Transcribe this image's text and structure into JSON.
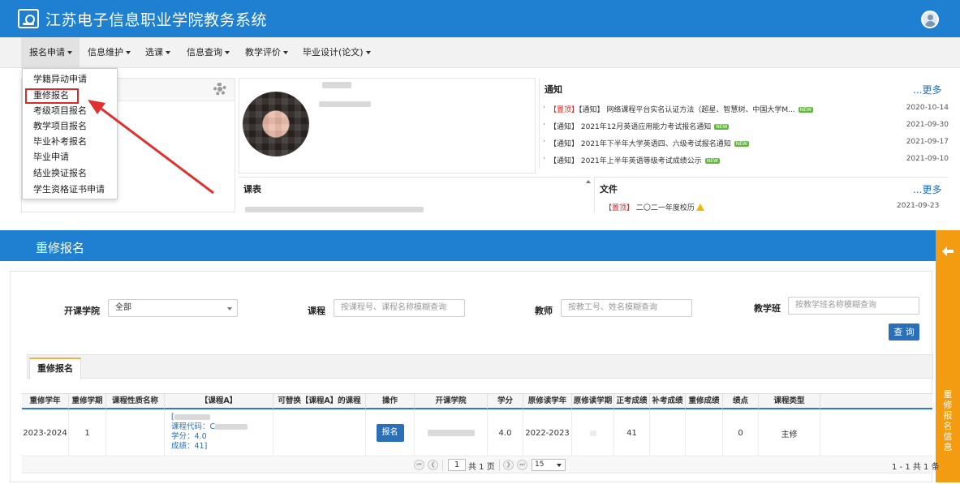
{
  "top": {
    "app_title": "江苏电子信息职业学院教务系统",
    "nav": [
      {
        "label": "报名申请"
      },
      {
        "label": "信息维护"
      },
      {
        "label": "选课"
      },
      {
        "label": "信息查询"
      },
      {
        "label": "教学评价"
      },
      {
        "label": "毕业设计(论文)"
      }
    ],
    "dropdown_items": [
      "学籍异动申请",
      "重修报名",
      "考级项目报名",
      "教学项目报名",
      "毕业补考报名",
      "毕业申请",
      "结业换证报名",
      "学生资格证书申请"
    ],
    "notice": {
      "title": "通知",
      "more": "...更多",
      "rows": [
        {
          "dot": "·",
          "text_red": "【置顶】",
          "text": "【通知】 网络课程平台实名认证方法（超星、智慧树、中国大学M...",
          "badge": "NEW",
          "date": "2020-10-14"
        },
        {
          "dot": "·",
          "text_red": "",
          "text": "【通知】 2021年12月英语应用能力考试报名通知",
          "badge": "NEW",
          "date": "2021-09-30"
        },
        {
          "dot": "·",
          "text_red": "",
          "text": "【通知】 2021年下半年大学英语四、六级考试报名通知",
          "badge": "NEW",
          "date": "2021-09-17"
        },
        {
          "dot": "·",
          "text_red": "",
          "text": "【通知】 2021年上半年英语等级考试成绩公示",
          "badge": "NEW",
          "date": "2021-09-10"
        }
      ]
    },
    "schedule_title": "课表",
    "files": {
      "title": "文件",
      "more": "...更多",
      "row_red": "【置顶】",
      "row_text": "二〇二一年度校历",
      "date": "2021-09-23"
    }
  },
  "bottom": {
    "page_title": "重修报名",
    "side_tab": "重修报名信息",
    "filters": {
      "college_label": "开课学院",
      "college_value": "全部",
      "course_label": "课程",
      "course_placeholder": "按课程号、课程名称模糊查询",
      "teacher_label": "教师",
      "teacher_placeholder": "按教工号、姓名模糊查询",
      "class_label": "教学班",
      "class_placeholder": "按教学班名称模糊查询",
      "query_button": "查 询"
    },
    "tab_label": "重修报名",
    "table": {
      "columns": [
        "重修学年",
        "重修学期",
        "课程性质名称",
        "【课程A】",
        "可替换【课程A】的课程",
        "操作",
        "开课学院",
        "学分",
        "原修读学年",
        "原修读学期",
        "正考成绩",
        "补考成绩",
        "重修成绩",
        "绩点",
        "课程类型"
      ],
      "row": {
        "year": "2023-2024",
        "term": "1",
        "nature": "",
        "course_line1": "[",
        "course_line2": "课程代码：C",
        "course_line3": "学分：4.0",
        "course_line4": "成绩：41]",
        "alternative": "",
        "action": "报名",
        "college": "",
        "credit": "4.0",
        "orig_year": "2022-2023",
        "orig_term": "",
        "exam_score": "41",
        "makeup_score": "",
        "retake_score": "",
        "gpa": "0",
        "type": "主修"
      }
    },
    "pager": {
      "first": "⏮",
      "prev": "❮",
      "page": "1",
      "total_pages": "共 1 页",
      "next": "❯",
      "last": "⏭",
      "page_size": "15",
      "records": "1 - 1  共 1 条"
    }
  },
  "colors": {
    "header_blue": "#1f7fd1",
    "side_orange": "#f39c12",
    "button_blue": "#2a6fb8",
    "highlight_red": "#e02828"
  }
}
